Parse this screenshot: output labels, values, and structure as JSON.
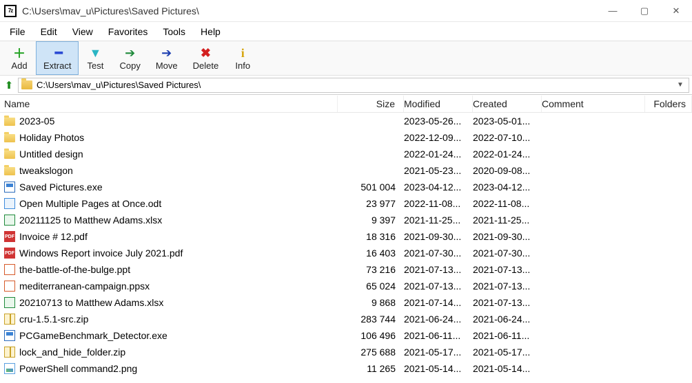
{
  "window": {
    "title": "C:\\Users\\mav_u\\Pictures\\Saved Pictures\\"
  },
  "menu": {
    "file": "File",
    "edit": "Edit",
    "view": "View",
    "favorites": "Favorites",
    "tools": "Tools",
    "help": "Help"
  },
  "toolbar": {
    "add": "Add",
    "extract": "Extract",
    "test": "Test",
    "copy": "Copy",
    "move": "Move",
    "delete": "Delete",
    "info": "Info"
  },
  "address": {
    "path": "C:\\Users\\mav_u\\Pictures\\Saved Pictures\\"
  },
  "columns": {
    "name": "Name",
    "size": "Size",
    "modified": "Modified",
    "created": "Created",
    "comment": "Comment",
    "folders": "Folders"
  },
  "files": [
    {
      "icon": "folder",
      "name": "2023-05",
      "size": "",
      "mod": "2023-05-26...",
      "crt": "2023-05-01..."
    },
    {
      "icon": "folder",
      "name": "Holiday Photos",
      "size": "",
      "mod": "2022-12-09...",
      "crt": "2022-07-10..."
    },
    {
      "icon": "folder",
      "name": "Untitled design",
      "size": "",
      "mod": "2022-01-24...",
      "crt": "2022-01-24..."
    },
    {
      "icon": "folder",
      "name": "tweakslogon",
      "size": "",
      "mod": "2021-05-23...",
      "crt": "2020-09-08..."
    },
    {
      "icon": "exe",
      "name": "Saved Pictures.exe",
      "size": "501 004",
      "mod": "2023-04-12...",
      "crt": "2023-04-12..."
    },
    {
      "icon": "doc",
      "name": "Open Multiple Pages at Once.odt",
      "size": "23 977",
      "mod": "2022-11-08...",
      "crt": "2022-11-08..."
    },
    {
      "icon": "xls",
      "name": "20211125 to Matthew Adams.xlsx",
      "size": "9 397",
      "mod": "2021-11-25...",
      "crt": "2021-11-25..."
    },
    {
      "icon": "pdf",
      "name": "Invoice # 12.pdf",
      "size": "18 316",
      "mod": "2021-09-30...",
      "crt": "2021-09-30..."
    },
    {
      "icon": "pdf",
      "name": "Windows Report invoice July 2021.pdf",
      "size": "16 403",
      "mod": "2021-07-30...",
      "crt": "2021-07-30..."
    },
    {
      "icon": "ppt",
      "name": "the-battle-of-the-bulge.ppt",
      "size": "73 216",
      "mod": "2021-07-13...",
      "crt": "2021-07-13..."
    },
    {
      "icon": "ppt",
      "name": "mediterranean-campaign.ppsx",
      "size": "65 024",
      "mod": "2021-07-13...",
      "crt": "2021-07-13..."
    },
    {
      "icon": "xls",
      "name": "20210713 to Matthew Adams.xlsx",
      "size": "9 868",
      "mod": "2021-07-14...",
      "crt": "2021-07-13..."
    },
    {
      "icon": "zip",
      "name": "cru-1.5.1-src.zip",
      "size": "283 744",
      "mod": "2021-06-24...",
      "crt": "2021-06-24..."
    },
    {
      "icon": "exe",
      "name": "PCGameBenchmark_Detector.exe",
      "size": "106 496",
      "mod": "2021-06-11...",
      "crt": "2021-06-11..."
    },
    {
      "icon": "zip",
      "name": "lock_and_hide_folder.zip",
      "size": "275 688",
      "mod": "2021-05-17...",
      "crt": "2021-05-17..."
    },
    {
      "icon": "png",
      "name": "PowerShell command2.png",
      "size": "11 265",
      "mod": "2021-05-14...",
      "crt": "2021-05-14..."
    }
  ]
}
